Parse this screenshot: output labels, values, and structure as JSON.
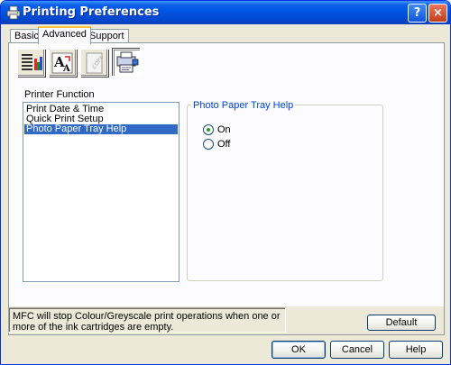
{
  "window": {
    "title": "Printing Preferences",
    "help_label": "?",
    "close_label": "×"
  },
  "tabs": [
    {
      "label": "Basic"
    },
    {
      "label": "Advanced",
      "active": true
    },
    {
      "label": "Support"
    }
  ],
  "toolbar": {
    "buttons": [
      {
        "icon": "color-bars-icon"
      },
      {
        "icon": "font-scaling-icon"
      },
      {
        "icon": "copy-stamp-icon"
      },
      {
        "icon": "device-options-icon",
        "pressed": true
      }
    ]
  },
  "printer_function": {
    "label": "Printer Function",
    "items": [
      "Print Date & Time",
      "Quick Print Setup",
      "Photo Paper Tray Help"
    ],
    "selected": "Photo Paper Tray Help"
  },
  "photo_tray_help": {
    "title": "Photo Paper Tray Help",
    "options": [
      {
        "label": "On",
        "checked": true
      },
      {
        "label": "Off",
        "checked": false
      }
    ]
  },
  "message": "MFC will stop Colour/Greyscale print operations when one or more of the ink cartridges are empty.",
  "buttons": {
    "default": "Default",
    "ok": "OK",
    "cancel": "Cancel",
    "help": "Help"
  },
  "colors": {
    "titlebar": "#0054e3",
    "selection": "#316ac5",
    "group_title": "#0046d5",
    "tab_highlight": "#ffc83c"
  }
}
